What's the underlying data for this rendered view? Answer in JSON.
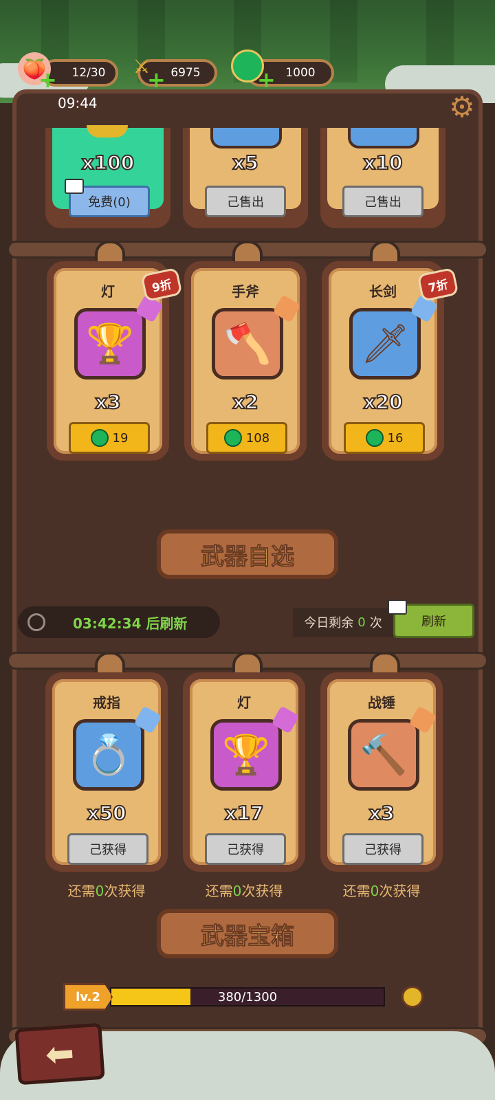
{
  "header": {
    "stamina": "12/30",
    "gold": "6975",
    "jade": "1000",
    "time": "09:44"
  },
  "top_row": [
    {
      "qty": "x100",
      "button": "免费(0)"
    },
    {
      "qty": "x5",
      "button": "己售出"
    },
    {
      "qty": "x10",
      "button": "己售出"
    }
  ],
  "shop_row": [
    {
      "name": "灯",
      "qty": "x3",
      "price": "19",
      "discount": "9折",
      "box_color": "#c85bc9",
      "piece_color": "#d46bd6"
    },
    {
      "name": "手斧",
      "qty": "x2",
      "price": "108",
      "discount": "",
      "box_color": "#e08a62",
      "piece_color": "#f09a5a"
    },
    {
      "name": "长剑",
      "qty": "x20",
      "price": "16",
      "discount": "7折",
      "box_color": "#5e9ee0",
      "piece_color": "#7fb4ee"
    }
  ],
  "weapon_select": {
    "title": "武器自选",
    "timer": "03:42:34 后刷新",
    "remaining_prefix": "今日剩余",
    "remaining_count": "0",
    "remaining_suffix": "次",
    "refresh": "刷新"
  },
  "choice_row": [
    {
      "name": "戒指",
      "qty": "x50",
      "button": "己获得",
      "box_color": "#5e9ee0",
      "piece_color": "#7fb4ee"
    },
    {
      "name": "灯",
      "qty": "x17",
      "button": "己获得",
      "box_color": "#c85bc9",
      "piece_color": "#d46bd6"
    },
    {
      "name": "战锤",
      "qty": "x3",
      "button": "己获得",
      "box_color": "#e08a62",
      "piece_color": "#f09a5a"
    }
  ],
  "need_text": {
    "prefix": "还需",
    "count": "0",
    "suffix": "次获得"
  },
  "chest": {
    "title": "武器宝箱",
    "level": "lv.2",
    "progress_text": "380/1300",
    "progress": 0.29
  }
}
